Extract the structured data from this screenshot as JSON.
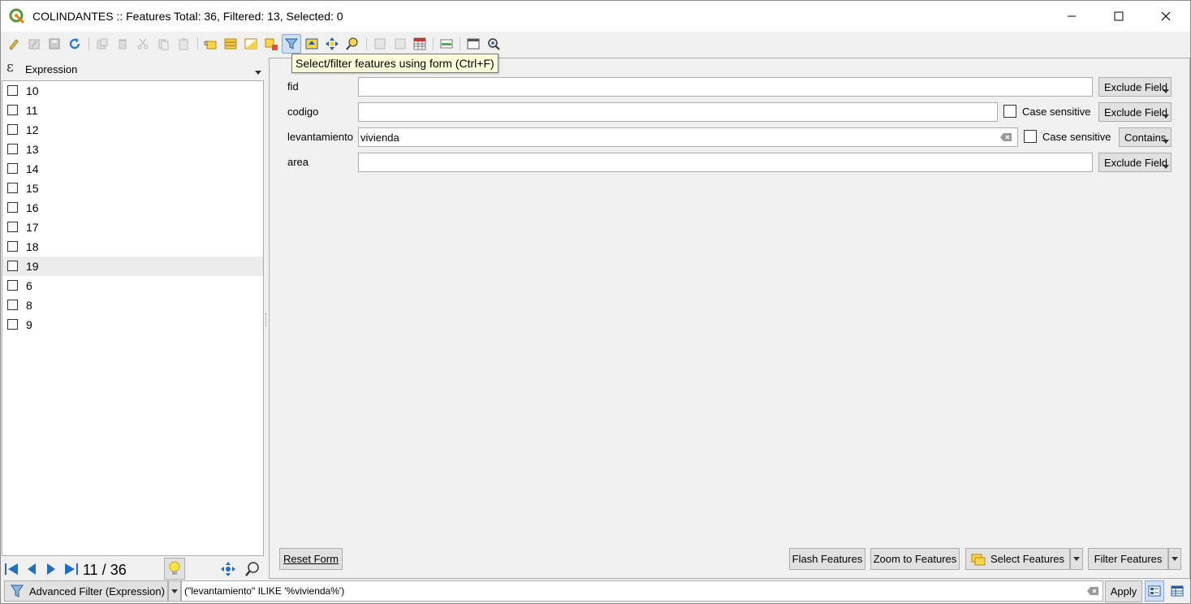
{
  "window": {
    "title": "COLINDANTES :: Features Total: 36, Filtered: 13, Selected: 0",
    "minimize_icon": "minimize-icon",
    "maximize_icon": "maximize-icon",
    "close_icon": "close-icon"
  },
  "toolbar": {
    "tooltip": "Select/filter features using form (Ctrl+F)",
    "icons": [
      "toggle-editing",
      "multi-edit",
      "save-edits",
      "reload",
      "add-feature",
      "delete-feature",
      "cut",
      "copy",
      "paste",
      "select-by-expression",
      "select-all",
      "invert-selection",
      "deselect-all",
      "filter-form",
      "move-selection-to-top",
      "pan-to-selection",
      "zoom-to-selection",
      "new-field",
      "delete-field",
      "field-calculator",
      "conditional-formatting",
      "dock",
      "actions"
    ]
  },
  "left_panel": {
    "header_label": "Expression",
    "items": [
      {
        "label": "10",
        "checked": false
      },
      {
        "label": "11",
        "checked": false
      },
      {
        "label": "12",
        "checked": false
      },
      {
        "label": "13",
        "checked": false
      },
      {
        "label": "14",
        "checked": false
      },
      {
        "label": "15",
        "checked": false
      },
      {
        "label": "16",
        "checked": false
      },
      {
        "label": "17",
        "checked": false
      },
      {
        "label": "18",
        "checked": false
      },
      {
        "label": "19",
        "checked": false
      },
      {
        "label": "6",
        "checked": false
      },
      {
        "label": "8",
        "checked": false
      },
      {
        "label": "9",
        "checked": false
      }
    ],
    "page_counter": "11 / 36"
  },
  "form": {
    "fields": [
      {
        "label": "fid",
        "value": "",
        "case_sensitive": null,
        "mode": "Exclude Field"
      },
      {
        "label": "codigo",
        "value": "",
        "case_sensitive_label": "Case sensitive",
        "case_sensitive": false,
        "mode": "Exclude Field"
      },
      {
        "label": "levantamiento",
        "value": "vivienda",
        "case_sensitive_label": "Case sensitive",
        "case_sensitive": false,
        "mode": "Contains"
      },
      {
        "label": "area",
        "value": "",
        "case_sensitive": null,
        "mode": "Exclude Field"
      }
    ],
    "reset_button": "Reset Form",
    "flash_button": "Flash Features",
    "zoom_button": "Zoom to Features",
    "select_button": "Select Features",
    "filter_button": "Filter Features"
  },
  "bottom_bar": {
    "filter_mode": "Advanced Filter (Expression)",
    "expression": "(\"levantamiento\" ILIKE '%vivienda%')",
    "apply_button": "Apply"
  },
  "colors": {
    "qgis_green": "#589632",
    "qgis_yellow": "#ee7913",
    "tooltip_bg": "#ffffdc",
    "active_button_bg": "#cfe0f5",
    "nav_blue": "#1f6fbf"
  }
}
